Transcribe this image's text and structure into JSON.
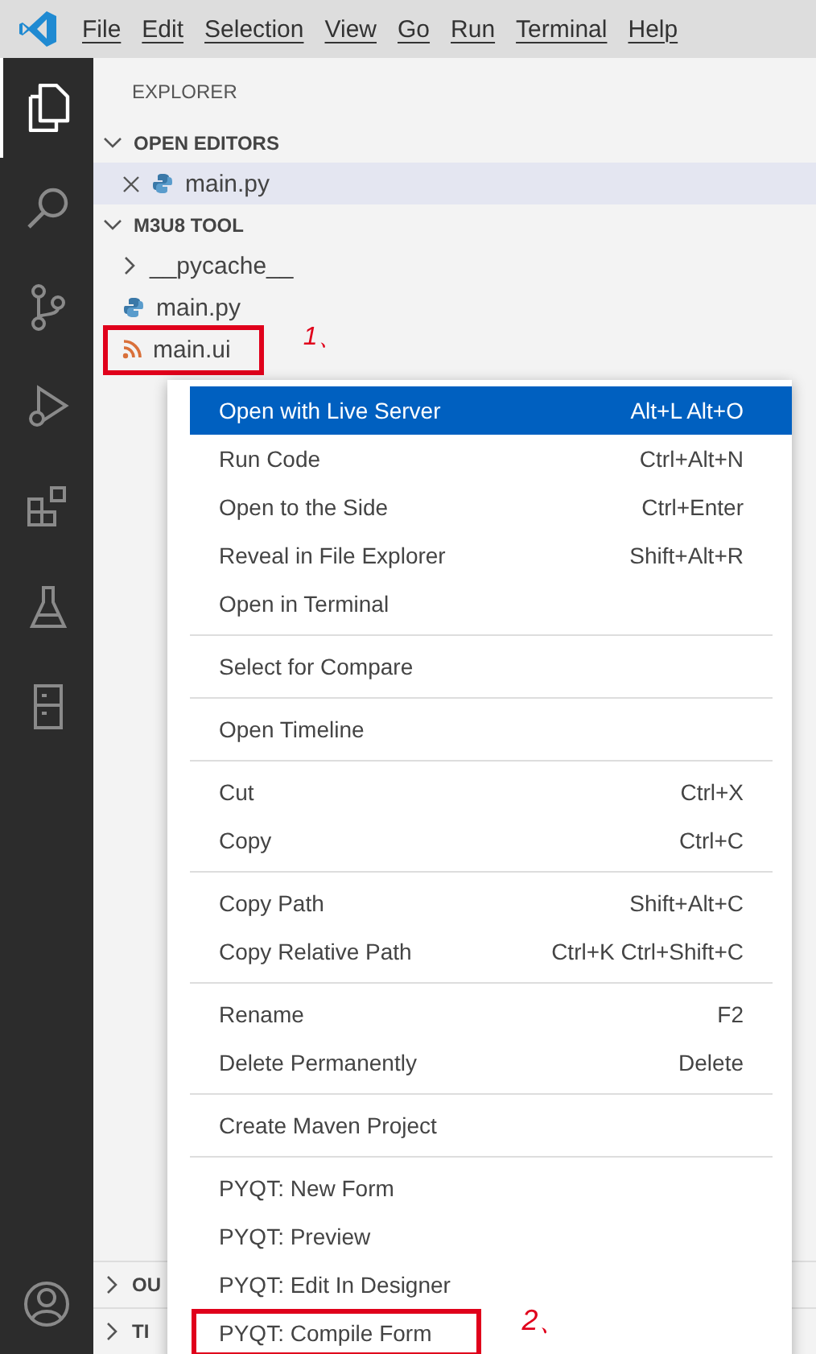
{
  "menu_bar": [
    "File",
    "Edit",
    "Selection",
    "View",
    "Go",
    "Run",
    "Terminal",
    "Help"
  ],
  "activity_bar": [
    {
      "kind": "files",
      "selected": true
    },
    {
      "kind": "search",
      "selected": false
    },
    {
      "kind": "source-control",
      "selected": false
    },
    {
      "kind": "run",
      "selected": false
    },
    {
      "kind": "extensions",
      "selected": false
    },
    {
      "kind": "testing",
      "selected": false
    },
    {
      "kind": "remote",
      "selected": false
    }
  ],
  "sidebar": {
    "title": "EXPLORER",
    "sections": [
      {
        "title": "OPEN EDITORS",
        "expanded": true,
        "items": [
          {
            "label": "main.py",
            "kind": "python",
            "selected": true,
            "closable": true
          }
        ]
      },
      {
        "title": "M3U8 TOOL",
        "expanded": true,
        "items": [
          {
            "label": "__pycache__",
            "kind": "folder",
            "selected": false,
            "closable": false
          },
          {
            "label": "main.py",
            "kind": "python",
            "selected": false,
            "closable": false
          },
          {
            "label": "main.ui",
            "kind": "feed",
            "selected": false,
            "closable": false,
            "annotation": "1、"
          }
        ]
      }
    ],
    "bottom_sections": [
      {
        "title": "OU",
        "expanded": false
      },
      {
        "title": "TI",
        "expanded": false
      }
    ]
  },
  "context_menu": [
    {
      "kind": "item",
      "label": "Open with Live Server",
      "shortcut": "Alt+L Alt+O",
      "selected": true
    },
    {
      "kind": "item",
      "label": "Run Code",
      "shortcut": "Ctrl+Alt+N",
      "selected": false
    },
    {
      "kind": "item",
      "label": "Open to the Side",
      "shortcut": "Ctrl+Enter",
      "selected": false
    },
    {
      "kind": "item",
      "label": "Reveal in File Explorer",
      "shortcut": "Shift+Alt+R",
      "selected": false
    },
    {
      "kind": "item",
      "label": "Open in Terminal",
      "selected": false
    },
    {
      "kind": "separator"
    },
    {
      "kind": "item",
      "label": "Select for Compare",
      "selected": false
    },
    {
      "kind": "separator"
    },
    {
      "kind": "item",
      "label": "Open Timeline",
      "selected": false
    },
    {
      "kind": "separator"
    },
    {
      "kind": "item",
      "label": "Cut",
      "shortcut": "Ctrl+X",
      "selected": false
    },
    {
      "kind": "item",
      "label": "Copy",
      "shortcut": "Ctrl+C",
      "selected": false
    },
    {
      "kind": "separator"
    },
    {
      "kind": "item",
      "label": "Copy Path",
      "shortcut": "Shift+Alt+C",
      "selected": false
    },
    {
      "kind": "item",
      "label": "Copy Relative Path",
      "shortcut": "Ctrl+K Ctrl+Shift+C",
      "selected": false
    },
    {
      "kind": "separator"
    },
    {
      "kind": "item",
      "label": "Rename",
      "shortcut": "F2",
      "selected": false
    },
    {
      "kind": "item",
      "label": "Delete Permanently",
      "shortcut": "Delete",
      "selected": false
    },
    {
      "kind": "separator"
    },
    {
      "kind": "item",
      "label": "Create Maven Project",
      "selected": false
    },
    {
      "kind": "separator"
    },
    {
      "kind": "item",
      "label": "PYQT: New Form",
      "selected": false
    },
    {
      "kind": "item",
      "label": "PYQT: Preview",
      "selected": false
    },
    {
      "kind": "item",
      "label": "PYQT: Edit In Designer",
      "selected": false
    },
    {
      "kind": "item",
      "label": "PYQT: Compile Form",
      "selected": false,
      "annotation": "2、"
    }
  ]
}
